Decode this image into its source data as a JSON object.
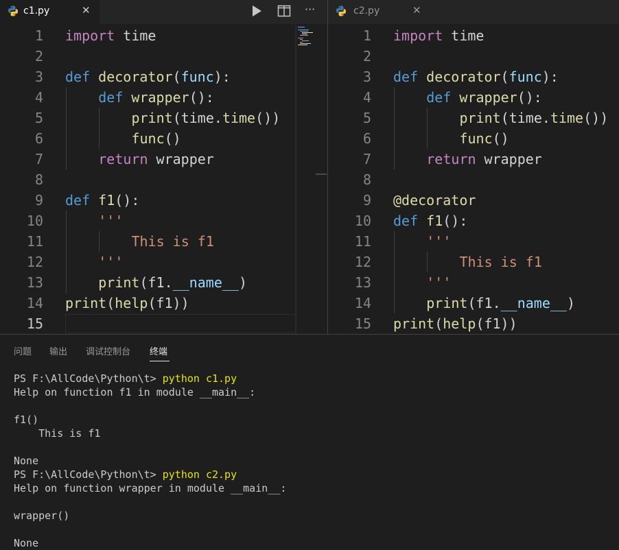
{
  "colors": {
    "keyword": "#569cd6",
    "control_keyword": "#c586c0",
    "function": "#dcdcaa",
    "parameter": "#9cdcfe",
    "string": "#ce9178",
    "command": "#e5e510",
    "background": "#1e1e1e"
  },
  "left_editor": {
    "tab": {
      "label": "c1.py",
      "icon": "python-icon",
      "close": "✕"
    },
    "toolbar": {
      "run": "run-icon",
      "split": "split-editor-icon",
      "more": "···"
    },
    "lines": [
      {
        "n": "1",
        "indent": 0,
        "tokens": [
          [
            "kw2",
            "import"
          ],
          [
            "plain",
            " time"
          ]
        ]
      },
      {
        "n": "2",
        "indent": 0,
        "tokens": []
      },
      {
        "n": "3",
        "indent": 0,
        "tokens": [
          [
            "kw",
            "def"
          ],
          [
            "plain",
            " "
          ],
          [
            "fn",
            "decorator"
          ],
          [
            "plain",
            "("
          ],
          [
            "pm",
            "func"
          ],
          [
            "plain",
            "):"
          ]
        ]
      },
      {
        "n": "4",
        "indent": 1,
        "tokens": [
          [
            "kw",
            "def"
          ],
          [
            "plain",
            " "
          ],
          [
            "fn",
            "wrapper"
          ],
          [
            "plain",
            "():"
          ]
        ]
      },
      {
        "n": "5",
        "indent": 2,
        "tokens": [
          [
            "fn",
            "print"
          ],
          [
            "plain",
            "(time."
          ],
          [
            "fn",
            "time"
          ],
          [
            "plain",
            "())"
          ]
        ]
      },
      {
        "n": "6",
        "indent": 2,
        "tokens": [
          [
            "fn",
            "func"
          ],
          [
            "plain",
            "()"
          ]
        ]
      },
      {
        "n": "7",
        "indent": 1,
        "tokens": [
          [
            "kw2",
            "return"
          ],
          [
            "plain",
            " wrapper"
          ]
        ]
      },
      {
        "n": "8",
        "indent": 0,
        "tokens": []
      },
      {
        "n": "9",
        "indent": 0,
        "tokens": [
          [
            "kw",
            "def"
          ],
          [
            "plain",
            " "
          ],
          [
            "fn",
            "f1"
          ],
          [
            "plain",
            "():"
          ]
        ]
      },
      {
        "n": "10",
        "indent": 1,
        "tokens": [
          [
            "str",
            "'''"
          ]
        ]
      },
      {
        "n": "11",
        "indent": 2,
        "tokens": [
          [
            "str",
            "This is f1"
          ]
        ]
      },
      {
        "n": "12",
        "indent": 1,
        "tokens": [
          [
            "str",
            "'''"
          ]
        ]
      },
      {
        "n": "13",
        "indent": 1,
        "tokens": [
          [
            "fn",
            "print"
          ],
          [
            "plain",
            "(f1."
          ],
          [
            "pm",
            "__name__"
          ],
          [
            "plain",
            ")"
          ]
        ]
      },
      {
        "n": "14",
        "indent": 0,
        "tokens": [
          [
            "fn",
            "print"
          ],
          [
            "plain",
            "("
          ],
          [
            "fn",
            "help"
          ],
          [
            "plain",
            "(f1))"
          ]
        ]
      },
      {
        "n": "15",
        "indent": 0,
        "tokens": []
      }
    ]
  },
  "right_editor": {
    "tab": {
      "label": "c2.py",
      "icon": "python-icon",
      "close": "✕"
    },
    "lines": [
      {
        "n": "1",
        "indent": 0,
        "tokens": [
          [
            "kw2",
            "import"
          ],
          [
            "plain",
            " time"
          ]
        ]
      },
      {
        "n": "2",
        "indent": 0,
        "tokens": []
      },
      {
        "n": "3",
        "indent": 0,
        "tokens": [
          [
            "kw",
            "def"
          ],
          [
            "plain",
            " "
          ],
          [
            "fn",
            "decorator"
          ],
          [
            "plain",
            "("
          ],
          [
            "pm",
            "func"
          ],
          [
            "plain",
            "):"
          ]
        ]
      },
      {
        "n": "4",
        "indent": 1,
        "tokens": [
          [
            "kw",
            "def"
          ],
          [
            "plain",
            " "
          ],
          [
            "fn",
            "wrapper"
          ],
          [
            "plain",
            "():"
          ]
        ]
      },
      {
        "n": "5",
        "indent": 2,
        "tokens": [
          [
            "fn",
            "print"
          ],
          [
            "plain",
            "(time."
          ],
          [
            "fn",
            "time"
          ],
          [
            "plain",
            "())"
          ]
        ]
      },
      {
        "n": "6",
        "indent": 2,
        "tokens": [
          [
            "fn",
            "func"
          ],
          [
            "plain",
            "()"
          ]
        ]
      },
      {
        "n": "7",
        "indent": 1,
        "tokens": [
          [
            "kw2",
            "return"
          ],
          [
            "plain",
            " wrapper"
          ]
        ]
      },
      {
        "n": "8",
        "indent": 0,
        "tokens": []
      },
      {
        "n": "9",
        "indent": 0,
        "tokens": [
          [
            "fn",
            "@decorator"
          ]
        ]
      },
      {
        "n": "10",
        "indent": 0,
        "tokens": [
          [
            "kw",
            "def"
          ],
          [
            "plain",
            " "
          ],
          [
            "fn",
            "f1"
          ],
          [
            "plain",
            "():"
          ]
        ]
      },
      {
        "n": "11",
        "indent": 1,
        "tokens": [
          [
            "str",
            "'''"
          ]
        ]
      },
      {
        "n": "12",
        "indent": 2,
        "tokens": [
          [
            "str",
            "This is f1"
          ]
        ]
      },
      {
        "n": "13",
        "indent": 1,
        "tokens": [
          [
            "str",
            "'''"
          ]
        ]
      },
      {
        "n": "14",
        "indent": 1,
        "tokens": [
          [
            "fn",
            "print"
          ],
          [
            "plain",
            "(f1."
          ],
          [
            "pm",
            "__name__"
          ],
          [
            "plain",
            ")"
          ]
        ]
      },
      {
        "n": "15",
        "indent": 0,
        "tokens": [
          [
            "fn",
            "print"
          ],
          [
            "plain",
            "("
          ],
          [
            "fn",
            "help"
          ],
          [
            "plain",
            "(f1))"
          ]
        ]
      }
    ]
  },
  "panel": {
    "tabs": [
      "问题",
      "输出",
      "调试控制台",
      "终端"
    ],
    "active_tab": "终端",
    "terminal_lines": [
      {
        "prompt": "PS F:\\AllCode\\Python\\t> ",
        "cmd": "python c1.py"
      },
      {
        "text": "Help on function f1 in module __main__:"
      },
      {
        "text": ""
      },
      {
        "text": "f1()"
      },
      {
        "text": "    This is f1"
      },
      {
        "text": ""
      },
      {
        "text": "None"
      },
      {
        "prompt": "PS F:\\AllCode\\Python\\t> ",
        "cmd": "python c2.py"
      },
      {
        "text": "Help on function wrapper in module __main__:"
      },
      {
        "text": ""
      },
      {
        "text": "wrapper()"
      },
      {
        "text": ""
      },
      {
        "text": "None"
      }
    ]
  }
}
